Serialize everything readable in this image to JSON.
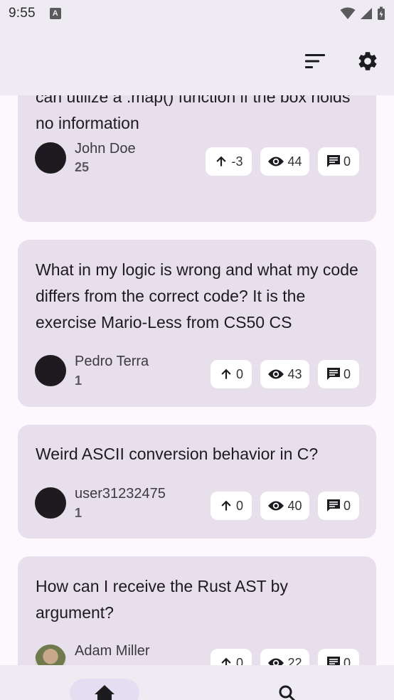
{
  "status_bar": {
    "time": "9:55",
    "notification_glyph": "A"
  },
  "colors": {
    "surface": "#efebf2",
    "card": "#e7e0ec",
    "background": "#fdf8fd",
    "chip": "#ffffff",
    "nav_indicator": "#e5def3"
  },
  "posts": [
    {
      "title": "can utilize a .map() function if the box holds no information",
      "author": "John Doe",
      "reputation": "25",
      "votes": "-3",
      "views": "44",
      "comments": "0"
    },
    {
      "title": "What in my logic is wrong and what my code differs from the correct code? It is the exercise Mario-Less from CS50 CS",
      "author": "Pedro Terra",
      "reputation": "1",
      "votes": "0",
      "views": "43",
      "comments": "0"
    },
    {
      "title": "Weird ASCII conversion behavior in C?",
      "author": "user31232475",
      "reputation": "1",
      "votes": "0",
      "views": "40",
      "comments": "0"
    },
    {
      "title": "How can I receive the Rust AST by argument?",
      "author": "Adam Miller",
      "votes": "0",
      "views": "22",
      "comments": "0"
    }
  ]
}
